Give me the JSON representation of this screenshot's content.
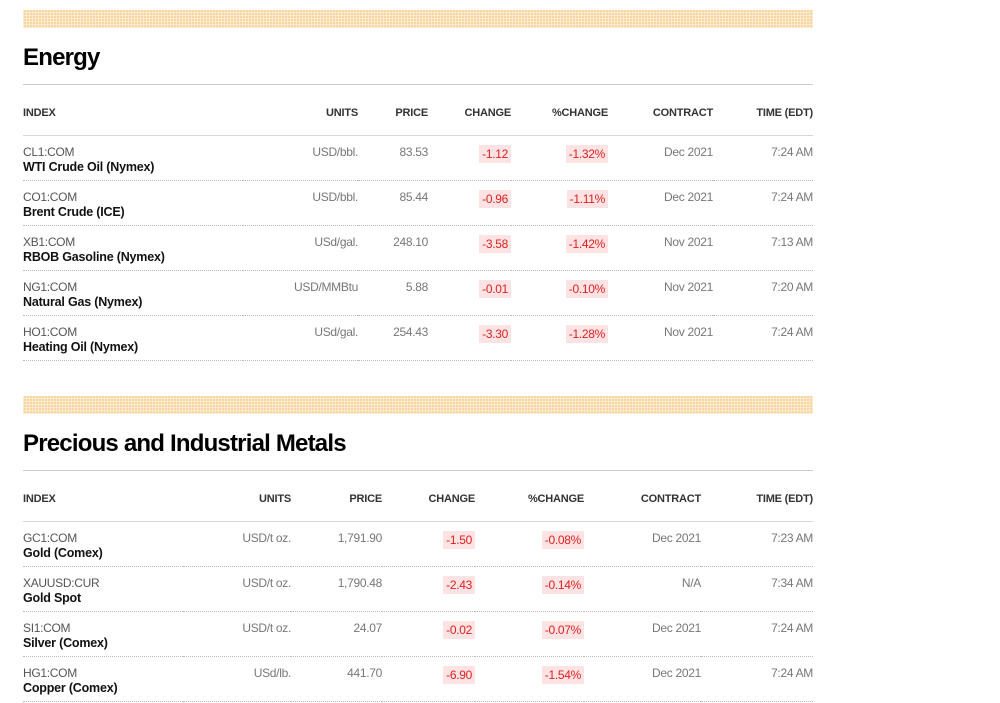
{
  "energy": {
    "title": "Energy",
    "headers": {
      "index": "INDEX",
      "units": "UNITS",
      "price": "PRICE",
      "change": "CHANGE",
      "pct": "%CHANGE",
      "contract": "CONTRACT",
      "time": "TIME (EDT)"
    },
    "rows": [
      {
        "symbol": "CL1:COM",
        "name": "WTI Crude Oil (Nymex)",
        "units": "USD/bbl.",
        "price": "83.53",
        "change": "-1.12",
        "pct": "-1.32%",
        "contract": "Dec 2021",
        "time": "7:24 AM"
      },
      {
        "symbol": "CO1:COM",
        "name": "Brent Crude (ICE)",
        "units": "USD/bbl.",
        "price": "85.44",
        "change": "-0.96",
        "pct": "-1.11%",
        "contract": "Dec 2021",
        "time": "7:24 AM"
      },
      {
        "symbol": "XB1:COM",
        "name": "RBOB Gasoline (Nymex)",
        "units": "USd/gal.",
        "price": "248.10",
        "change": "-3.58",
        "pct": "-1.42%",
        "contract": "Nov 2021",
        "time": "7:13 AM"
      },
      {
        "symbol": "NG1:COM",
        "name": "Natural Gas (Nymex)",
        "units": "USD/MMBtu",
        "price": "5.88",
        "change": "-0.01",
        "pct": "-0.10%",
        "contract": "Nov 2021",
        "time": "7:20 AM"
      },
      {
        "symbol": "HO1:COM",
        "name": "Heating Oil (Nymex)",
        "units": "USd/gal.",
        "price": "254.43",
        "change": "-3.30",
        "pct": "-1.28%",
        "contract": "Nov 2021",
        "time": "7:24 AM"
      }
    ]
  },
  "metals": {
    "title": "Precious and Industrial Metals",
    "headers": {
      "index": "INDEX",
      "units": "UNITS",
      "price": "PRICE",
      "change": "CHANGE",
      "pct": "%CHANGE",
      "contract": "CONTRACT",
      "time": "TIME (EDT)"
    },
    "rows": [
      {
        "symbol": "GC1:COM",
        "name": "Gold (Comex)",
        "units": "USD/t oz.",
        "price": "1,791.90",
        "change": "-1.50",
        "pct": "-0.08%",
        "contract": "Dec 2021",
        "time": "7:23 AM"
      },
      {
        "symbol": "XAUUSD:CUR",
        "name": "Gold Spot",
        "units": "USD/t oz.",
        "price": "1,790.48",
        "change": "-2.43",
        "pct": "-0.14%",
        "contract": "N/A",
        "time": "7:34 AM"
      },
      {
        "symbol": "SI1:COM",
        "name": "Silver (Comex)",
        "units": "USD/t oz.",
        "price": "24.07",
        "change": "-0.02",
        "pct": "-0.07%",
        "contract": "Dec 2021",
        "time": "7:24 AM"
      },
      {
        "symbol": "HG1:COM",
        "name": "Copper (Comex)",
        "units": "USd/lb.",
        "price": "441.70",
        "change": "-6.90",
        "pct": "-1.54%",
        "contract": "Dec 2021",
        "time": "7:24 AM"
      }
    ]
  }
}
